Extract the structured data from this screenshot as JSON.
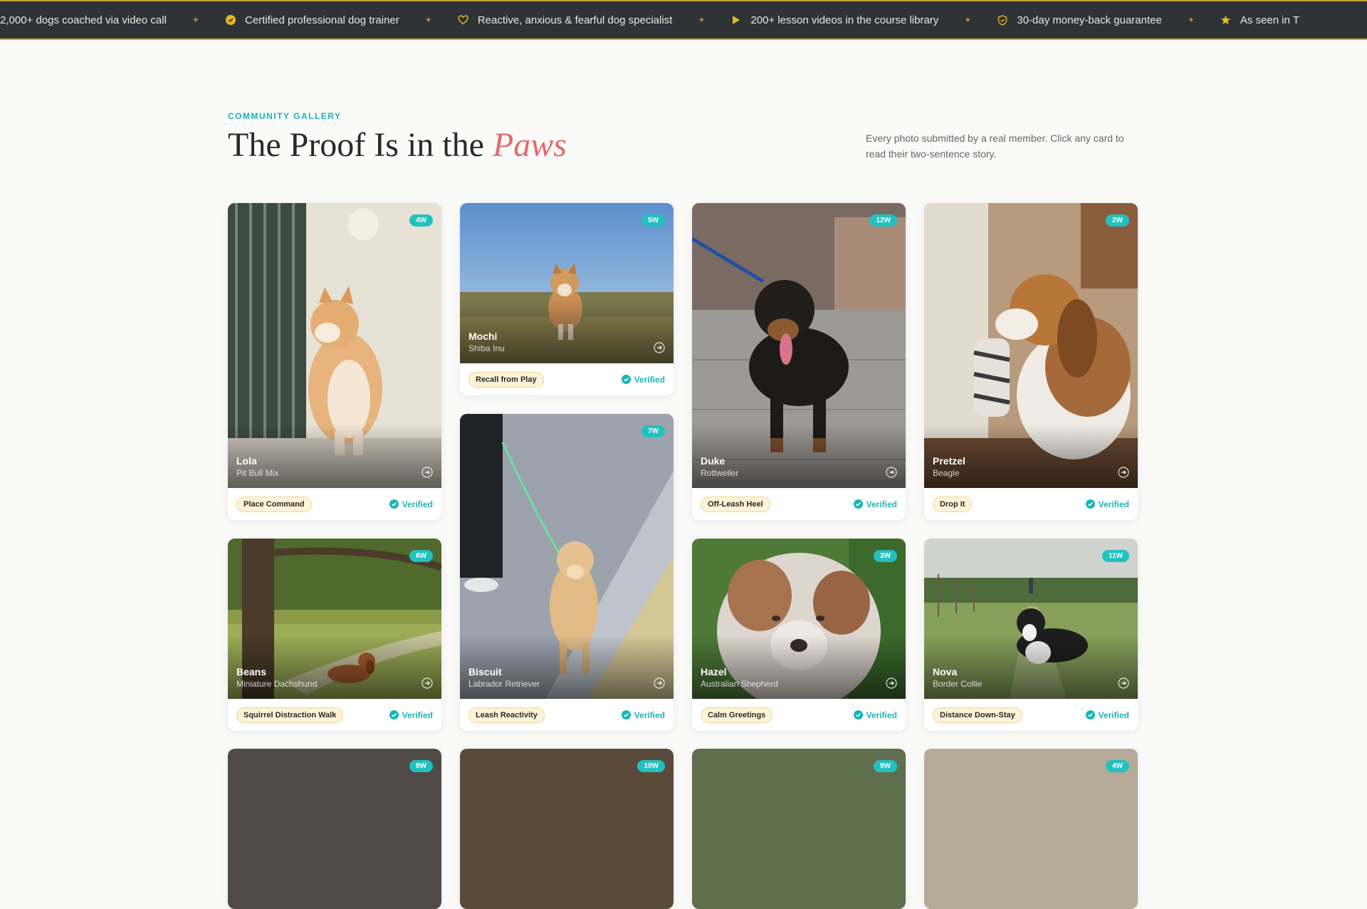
{
  "ticker": {
    "items": [
      {
        "icon": "none",
        "text": "2,000+ dogs coached via video call"
      },
      {
        "icon": "check-circle-icon",
        "text": "Certified professional dog trainer"
      },
      {
        "icon": "heart-icon",
        "text": "Reactive, anxious & fearful dog specialist"
      },
      {
        "icon": "play-icon",
        "text": "200+ lesson videos in the course library"
      },
      {
        "icon": "shield-icon",
        "text": "30-day money-back guarantee"
      },
      {
        "icon": "star-icon",
        "text": "As seen in T"
      }
    ],
    "separator": "✦"
  },
  "header": {
    "eyebrow": "COMMUNITY GALLERY",
    "title_main": "The Proof Is in the ",
    "title_accent": "Paws",
    "intro": "Every photo submitted by a real member. Click any card to read their two-sentence story."
  },
  "cards": [
    {
      "name": "Lola",
      "breed": "Pit Bull Mix",
      "weeks": "4W",
      "skill": "Place Command",
      "verified": "Verified"
    },
    {
      "name": "Mochi",
      "breed": "Shiba Inu",
      "weeks": "5W",
      "skill": "Recall from Play",
      "verified": "Verified"
    },
    {
      "name": "Duke",
      "breed": "Rottweiler",
      "weeks": "12W",
      "skill": "Off-Leash Heel",
      "verified": "Verified"
    },
    {
      "name": "Pretzel",
      "breed": "Beagle",
      "weeks": "2W",
      "skill": "Drop It",
      "verified": "Verified"
    },
    {
      "name": "Biscuit",
      "breed": "Labrador Retriever",
      "weeks": "7W",
      "skill": "Leash Reactivity",
      "verified": "Verified"
    },
    {
      "name": "Beans",
      "breed": "Miniature Dachshund",
      "weeks": "6W",
      "skill": "Squirrel Distraction Walk",
      "verified": "Verified"
    },
    {
      "name": "Hazel",
      "breed": "Australian Shepherd",
      "weeks": "3W",
      "skill": "Calm Greetings",
      "verified": "Verified"
    },
    {
      "name": "Nova",
      "breed": "Border Collie",
      "weeks": "11W",
      "skill": "Distance Down-Stay",
      "verified": "Verified"
    },
    {
      "weeks": "8W"
    },
    {
      "weeks": "10W"
    },
    {
      "weeks": "9W"
    },
    {
      "weeks": "4W"
    }
  ],
  "colors": {
    "accent": "#1bb5b5",
    "title_accent": "#e46a6a",
    "ticker_bg": "#2e3335",
    "gold": "#c9a33a"
  }
}
